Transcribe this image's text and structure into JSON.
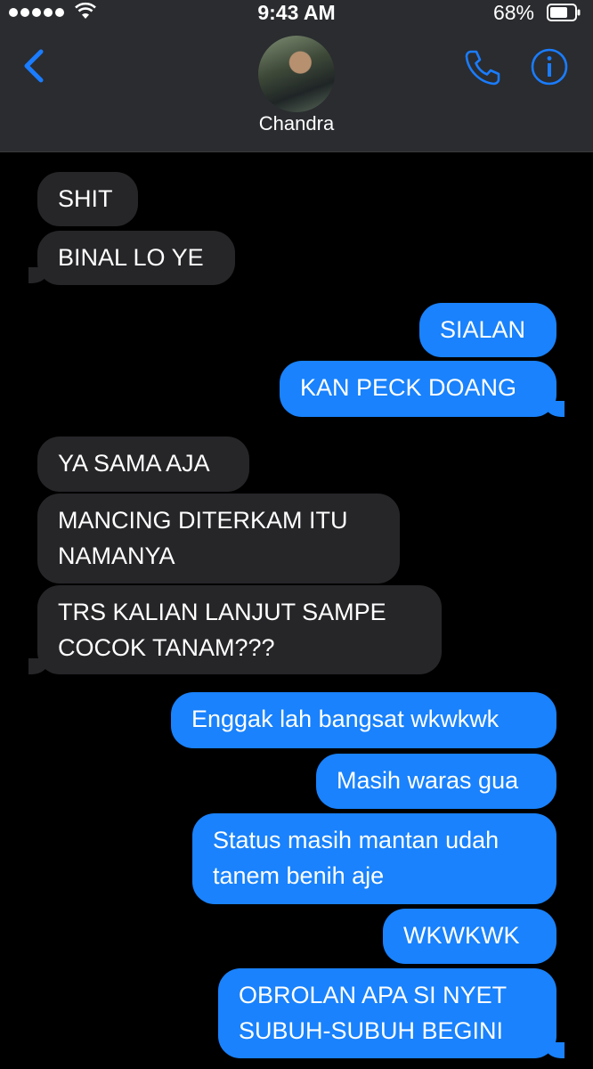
{
  "status_bar": {
    "time": "9:43 AM",
    "battery_percent": "68%",
    "signal_bars": 5
  },
  "header": {
    "contact_name": "Chandra"
  },
  "colors": {
    "incoming_bubble": "#262629",
    "outgoing_bubble": "#1982fc",
    "accent": "#1a7cff"
  },
  "messages": [
    {
      "direction": "in",
      "text": "SHIT"
    },
    {
      "direction": "in",
      "text": "BINAL LO YE"
    },
    {
      "direction": "out",
      "text": "SIALAN"
    },
    {
      "direction": "out",
      "text": "KAN PECK DOANG"
    },
    {
      "direction": "in",
      "text": "YA SAMA AJA"
    },
    {
      "direction": "in",
      "text": "MANCING DITERKAM ITU NAMANYA"
    },
    {
      "direction": "in",
      "text": "TRS KALIAN LANJUT SAMPE COCOK TANAM???"
    },
    {
      "direction": "out",
      "text": "Enggak lah bangsat wkwkwk"
    },
    {
      "direction": "out",
      "text": "Masih waras gua"
    },
    {
      "direction": "out",
      "text": "Status masih mantan udah tanem benih aje"
    },
    {
      "direction": "out",
      "text": "WKWKWK"
    },
    {
      "direction": "out",
      "text": "OBROLAN APA SI NYET SUBUH-SUBUH BEGINI"
    }
  ]
}
